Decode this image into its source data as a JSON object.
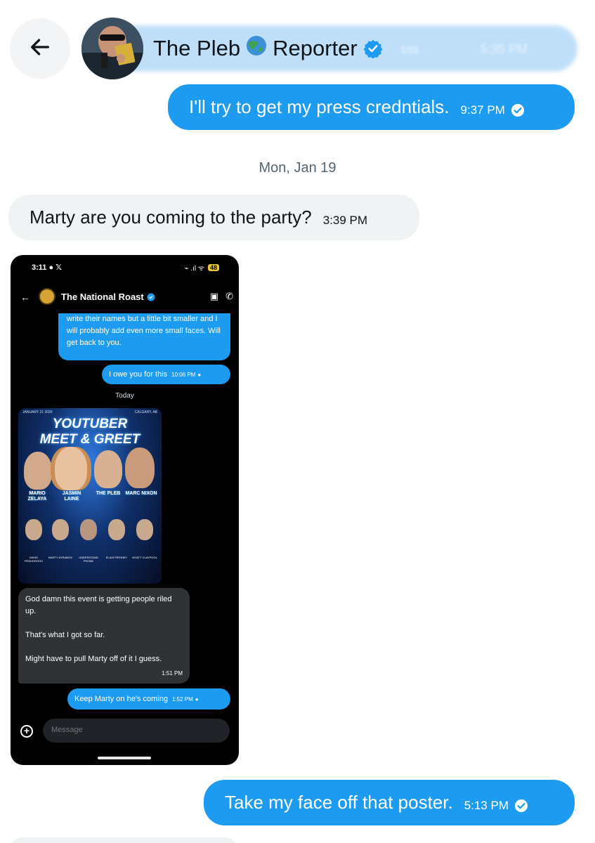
{
  "header": {
    "title_part1": "The Pleb",
    "title_part2": "Reporter",
    "ghost_text": "sss ·",
    "ghost_time": "5:35 PM"
  },
  "messages": [
    {
      "text": "I'll try to get my press credntials.",
      "time": "9:37 PM"
    },
    {
      "text": "Marty are you coming to the party?",
      "time": "3:39 PM"
    },
    {
      "text": "Take my face off that poster.",
      "time": "5:13 PM"
    }
  ],
  "date_separator": "Mon, Jan 19",
  "phone": {
    "status_time": "3:11",
    "status_icons": "✈ ⏻ 𝕏",
    "battery": "48",
    "contact_name": "The National Roast",
    "bubble1": "write their names but a little bit smaller and I will probably add even more small faces. Will get back to you.",
    "bubble2": "I owe you for this",
    "bubble2_time": "10:06 PM",
    "today": "Today",
    "poster_title1": "YOUTUBER",
    "poster_title2": "MEET & GREET",
    "poster_date": "JANUARY 21 2026",
    "poster_location": "CALGARY, AB",
    "poster_names": [
      "MARIO ZELAYA",
      "JASMIN LAINE",
      "THE PLEB",
      "MARC NIXON"
    ],
    "poster_small_names": [
      "DAVID PENHOROOD",
      "MARTY AYRAMOV",
      "UNDERSTAND PHONE",
      "ELIAS PIRONEY",
      "WYATT CLAYPOOL"
    ],
    "incoming1": "God damn this event is getting people riled up.",
    "incoming2": "That's what I got so far.",
    "incoming3": "Might have to pull Marty off of it I guess.",
    "incoming_time": "1:51 PM",
    "outgoing_last": "Keep Marty on he's coming",
    "outgoing_last_time": "1:52 PM",
    "input_placeholder": "Message"
  },
  "colors": {
    "accent": "#1d9bf0",
    "incoming_bg": "#eff3f4",
    "timestamp": "#536471"
  }
}
